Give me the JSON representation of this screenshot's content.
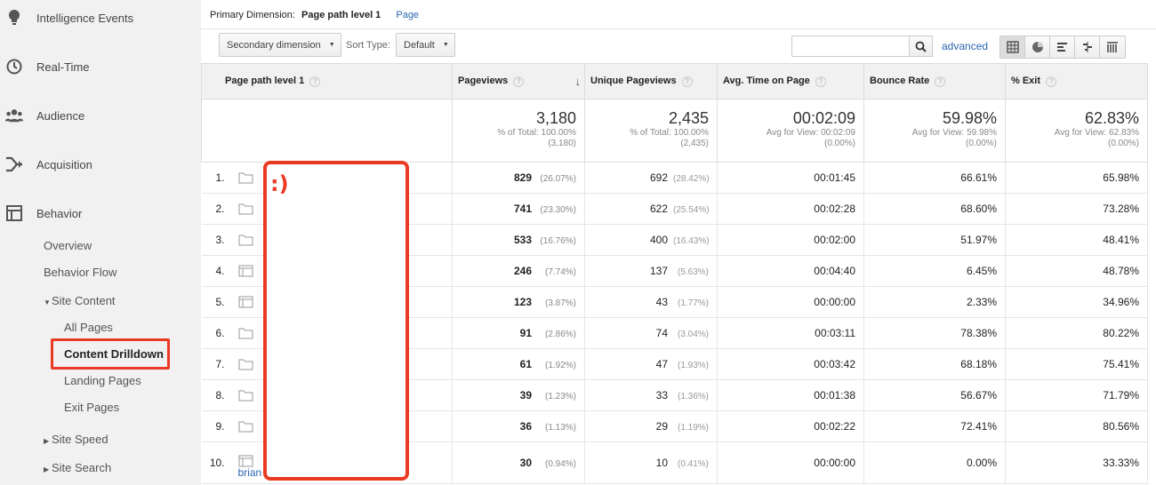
{
  "sidebar": {
    "top_items": [
      {
        "label": "Intelligence Events",
        "icon": "lightbulb-icon"
      },
      {
        "label": "Real-Time",
        "icon": "clock-icon"
      },
      {
        "label": "Audience",
        "icon": "people-icon"
      },
      {
        "label": "Acquisition",
        "icon": "acquisition-icon"
      },
      {
        "label": "Behavior",
        "icon": "behavior-icon"
      }
    ],
    "behavior_items": [
      {
        "label": "Overview"
      },
      {
        "label": "Behavior Flow"
      },
      {
        "label": "Site Content",
        "expanded": true
      },
      {
        "label": "All Pages"
      },
      {
        "label": "Content Drilldown",
        "selected": true
      },
      {
        "label": "Landing Pages"
      },
      {
        "label": "Exit Pages"
      },
      {
        "label": "Site Speed",
        "expanded": false
      },
      {
        "label": "Site Search",
        "expanded": false
      }
    ]
  },
  "toolbar": {
    "primary_dimension_label": "Primary Dimension:",
    "primary_dimension_value": "Page path level 1",
    "alt_dimension": "Page",
    "secondary_dimension": "Secondary dimension",
    "sort_type_label": "Sort Type:",
    "sort_type_value": "Default",
    "search_value": "",
    "advanced": "advanced"
  },
  "table": {
    "headers": {
      "dimension": "Page path level 1",
      "pageviews": "Pageviews",
      "unique_pageviews": "Unique Pageviews",
      "avg_time": "Avg. Time on Page",
      "bounce_rate": "Bounce Rate",
      "exit": "% Exit"
    },
    "totals": {
      "pageviews": {
        "value": "3,180",
        "line1": "% of Total: 100.00%",
        "line2": "(3,180)"
      },
      "unique_pageviews": {
        "value": "2,435",
        "line1": "% of Total: 100.00%",
        "line2": "(2,435)"
      },
      "avg_time": {
        "value": "00:02:09",
        "line1": "Avg for View: 00:02:09",
        "line2": "(0.00%)"
      },
      "bounce_rate": {
        "value": "59.98%",
        "line1": "Avg for View: 59.98%",
        "line2": "(0.00%)"
      },
      "exit": {
        "value": "62.83%",
        "line1": "Avg for View: 62.83%",
        "line2": "(0.00%)"
      }
    },
    "rows": [
      {
        "n": "1.",
        "type": "folder",
        "pv": "829",
        "pv_pct": "(26.07%)",
        "upv": "692",
        "upv_pct": "(28.42%)",
        "time": "00:01:45",
        "bounce": "66.61%",
        "exit": "65.98%"
      },
      {
        "n": "2.",
        "type": "folder",
        "pv": "741",
        "pv_pct": "(23.30%)",
        "upv": "622",
        "upv_pct": "(25.54%)",
        "time": "00:02:28",
        "bounce": "68.60%",
        "exit": "73.28%"
      },
      {
        "n": "3.",
        "type": "folder",
        "pv": "533",
        "pv_pct": "(16.76%)",
        "upv": "400",
        "upv_pct": "(16.43%)",
        "time": "00:02:00",
        "bounce": "51.97%",
        "exit": "48.41%"
      },
      {
        "n": "4.",
        "type": "page",
        "pv": "246",
        "pv_pct": "(7.74%)",
        "upv": "137",
        "upv_pct": "(5.63%)",
        "time": "00:04:40",
        "bounce": "6.45%",
        "exit": "48.78%"
      },
      {
        "n": "5.",
        "type": "page",
        "pv": "123",
        "pv_pct": "(3.87%)",
        "upv": "43",
        "upv_pct": "(1.77%)",
        "time": "00:00:00",
        "bounce": "2.33%",
        "exit": "34.96%"
      },
      {
        "n": "6.",
        "type": "folder",
        "pv": "91",
        "pv_pct": "(2.86%)",
        "upv": "74",
        "upv_pct": "(3.04%)",
        "time": "00:03:11",
        "bounce": "78.38%",
        "exit": "80.22%"
      },
      {
        "n": "7.",
        "type": "folder",
        "pv": "61",
        "pv_pct": "(1.92%)",
        "upv": "47",
        "upv_pct": "(1.93%)",
        "time": "00:03:42",
        "bounce": "68.18%",
        "exit": "75.41%"
      },
      {
        "n": "8.",
        "type": "folder",
        "pv": "39",
        "pv_pct": "(1.23%)",
        "upv": "33",
        "upv_pct": "(1.36%)",
        "time": "00:01:38",
        "bounce": "56.67%",
        "exit": "71.79%"
      },
      {
        "n": "9.",
        "type": "folder",
        "pv": "36",
        "pv_pct": "(1.13%)",
        "upv": "29",
        "upv_pct": "(1.19%)",
        "time": "00:02:22",
        "bounce": "72.41%",
        "exit": "80.56%"
      },
      {
        "n": "10.",
        "type": "page",
        "link": "brian",
        "pv": "30",
        "pv_pct": "(0.94%)",
        "upv": "10",
        "upv_pct": "(0.41%)",
        "time": "00:00:00",
        "bounce": "0.00%",
        "exit": "33.33%"
      }
    ]
  },
  "annotation": {
    "text": ":)"
  },
  "colors": {
    "accent": "#ea3a23",
    "link": "#2a67b1",
    "sidebar_bg": "#f1f1f1"
  }
}
